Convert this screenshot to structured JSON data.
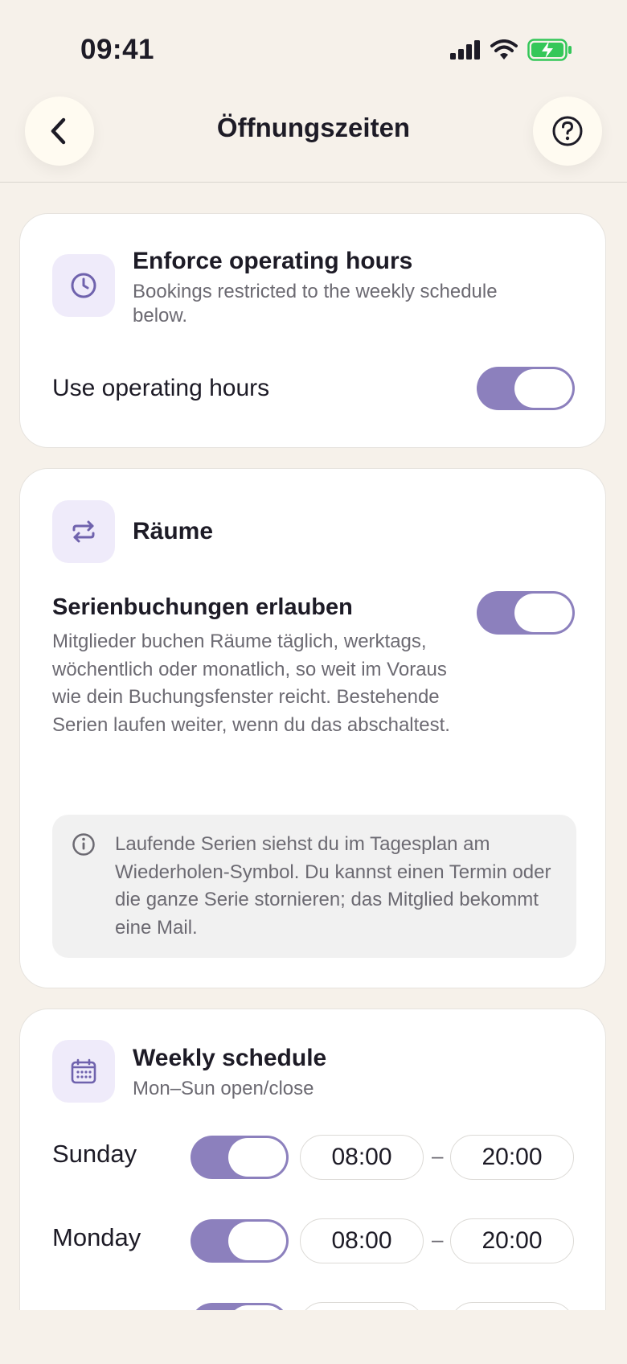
{
  "status": {
    "time": "09:41"
  },
  "header": {
    "title": "Öffnungszeiten"
  },
  "operating": {
    "title": "Enforce operating hours",
    "subtitle": "Bookings restricted to the weekly schedule below.",
    "toggle_label": "Use operating hours",
    "toggle_on": true
  },
  "rooms": {
    "title": "Räume",
    "series_label": "Serienbuchungen erlauben",
    "series_on": true,
    "description": "Mitglieder buchen Räume täglich, werktags, wöchentlich oder monatlich, so weit im Voraus wie dein Buchungsfenster reicht. Bestehende Serien laufen weiter, wenn du das abschaltest.",
    "info": "Laufende Serien siehst du im Tagesplan am Wiederholen-Symbol. Du kannst einen Termin oder die ganze Serie stornieren; das Mitglied bekommt eine Mail."
  },
  "weekly": {
    "title": "Weekly schedule",
    "subtitle": "Mon–Sun open/close",
    "separator": "–",
    "days": [
      {
        "name": "Sunday",
        "enabled": true,
        "open": "08:00",
        "close": "20:00"
      },
      {
        "name": "Monday",
        "enabled": true,
        "open": "08:00",
        "close": "20:00"
      }
    ]
  },
  "colors": {
    "accent": "#8c80bd",
    "icon_tile": "#efebfa",
    "background": "#f6f1ea",
    "battery_green": "#34c759"
  },
  "icons": [
    "back-chevron-icon",
    "help-icon",
    "clock-icon",
    "repeat-icon",
    "info-icon",
    "calendar-icon",
    "signal-icon",
    "wifi-icon",
    "battery-charging-icon"
  ]
}
